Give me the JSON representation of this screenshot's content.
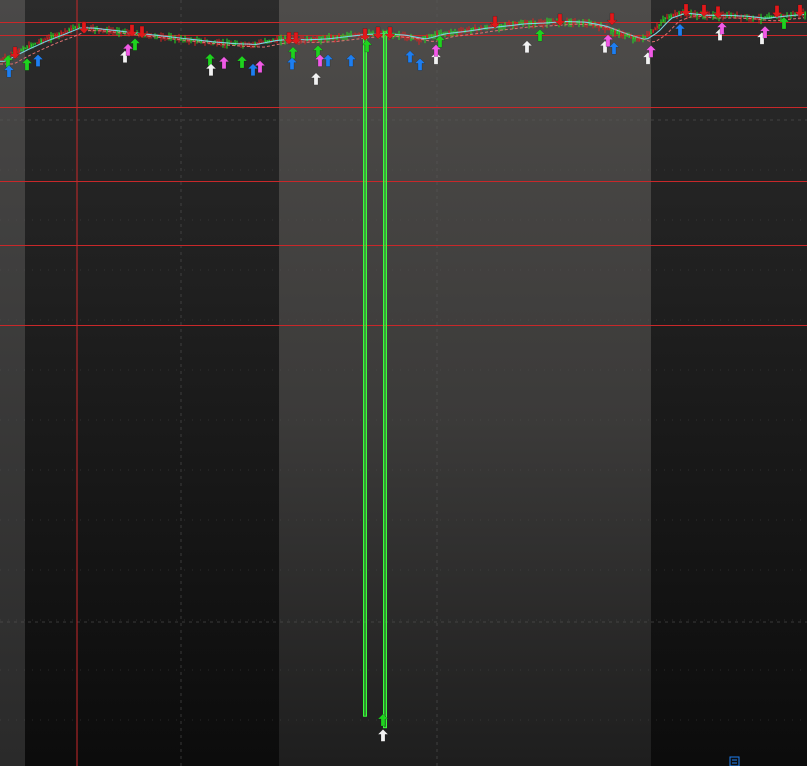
{
  "theme": {
    "bg_dark": "#0e0e0e",
    "bg_session_mid": "#3a3938",
    "bg_session_top": "#4a4948",
    "grid": "#5a5a5a",
    "level_line": "#c8282a",
    "bull": "#22e022",
    "bear": "#e02020",
    "ma_fast": "#7ad3e0",
    "ma_slow": "#e07070",
    "arrow_green": "#1fd21f",
    "arrow_red": "#e0191b",
    "arrow_blue": "#1e7ef0",
    "arrow_magenta": "#f05ae6",
    "arrow_white": "#f2f2f2",
    "spike": "#39ff39"
  },
  "chart_data": {
    "type": "candlestick",
    "title": "",
    "xlabel": "",
    "ylabel": "",
    "grid": true,
    "legend": "none",
    "ylim": [
      0,
      100
    ],
    "price_path": [
      [
        0,
        92.0
      ],
      [
        8,
        92.6
      ],
      [
        20,
        93.4
      ],
      [
        40,
        94.6
      ],
      [
        60,
        95.6
      ],
      [
        75,
        96.4
      ],
      [
        90,
        96.3
      ],
      [
        110,
        96.0
      ],
      [
        130,
        95.7
      ],
      [
        150,
        95.4
      ],
      [
        170,
        95.1
      ],
      [
        190,
        94.8
      ],
      [
        210,
        94.5
      ],
      [
        230,
        94.3
      ],
      [
        250,
        94.2
      ],
      [
        270,
        94.7
      ],
      [
        285,
        94.9
      ],
      [
        300,
        94.8
      ],
      [
        320,
        94.9
      ],
      [
        340,
        95.2
      ],
      [
        360,
        95.5
      ],
      [
        380,
        95.6
      ],
      [
        400,
        95.4
      ],
      [
        420,
        94.9
      ],
      [
        440,
        95.6
      ],
      [
        460,
        95.9
      ],
      [
        480,
        96.3
      ],
      [
        500,
        96.6
      ],
      [
        520,
        96.9
      ],
      [
        540,
        97.0
      ],
      [
        560,
        97.2
      ],
      [
        580,
        97.1
      ],
      [
        600,
        96.6
      ],
      [
        620,
        95.6
      ],
      [
        640,
        94.8
      ],
      [
        652,
        95.8
      ],
      [
        665,
        97.6
      ],
      [
        680,
        98.3
      ],
      [
        700,
        98.0
      ],
      [
        720,
        98.0
      ],
      [
        740,
        97.9
      ],
      [
        760,
        97.6
      ],
      [
        780,
        97.9
      ],
      [
        805,
        98.2
      ]
    ],
    "levels": [
      97.1,
      95.4,
      86.0,
      76.4,
      68.0,
      57.6
    ],
    "spikes": [
      {
        "x": 365,
        "low": 6.5
      },
      {
        "x": 385,
        "low": 5.0
      }
    ],
    "signals": [
      {
        "x": 8,
        "kind": "green",
        "dir": "up",
        "y": 92.0
      },
      {
        "x": 9,
        "kind": "blue",
        "dir": "up",
        "y": 90.7
      },
      {
        "x": 15,
        "kind": "red",
        "dir": "down",
        "y": 93.1
      },
      {
        "x": 27,
        "kind": "green",
        "dir": "up",
        "y": 91.6
      },
      {
        "x": 38,
        "kind": "blue",
        "dir": "up",
        "y": 92.1
      },
      {
        "x": 84,
        "kind": "red",
        "dir": "down",
        "y": 96.4
      },
      {
        "x": 125,
        "kind": "white",
        "dir": "up",
        "y": 92.6
      },
      {
        "x": 128,
        "kind": "magenta",
        "dir": "up",
        "y": 93.5
      },
      {
        "x": 132,
        "kind": "red",
        "dir": "down",
        "y": 96.0
      },
      {
        "x": 135,
        "kind": "green",
        "dir": "up",
        "y": 94.2
      },
      {
        "x": 142,
        "kind": "red",
        "dir": "down",
        "y": 95.8
      },
      {
        "x": 210,
        "kind": "green",
        "dir": "up",
        "y": 92.2
      },
      {
        "x": 211,
        "kind": "white",
        "dir": "up",
        "y": 90.9
      },
      {
        "x": 224,
        "kind": "magenta",
        "dir": "up",
        "y": 91.8
      },
      {
        "x": 242,
        "kind": "green",
        "dir": "up",
        "y": 91.9
      },
      {
        "x": 253,
        "kind": "blue",
        "dir": "up",
        "y": 90.9
      },
      {
        "x": 260,
        "kind": "magenta",
        "dir": "up",
        "y": 91.3
      },
      {
        "x": 289,
        "kind": "red",
        "dir": "down",
        "y": 95.0
      },
      {
        "x": 293,
        "kind": "green",
        "dir": "up",
        "y": 93.1
      },
      {
        "x": 296,
        "kind": "red",
        "dir": "down",
        "y": 95.0
      },
      {
        "x": 292,
        "kind": "blue",
        "dir": "up",
        "y": 91.7
      },
      {
        "x": 316,
        "kind": "white",
        "dir": "up",
        "y": 89.7
      },
      {
        "x": 318,
        "kind": "green",
        "dir": "up",
        "y": 93.3
      },
      {
        "x": 320,
        "kind": "magenta",
        "dir": "up",
        "y": 92.1
      },
      {
        "x": 328,
        "kind": "blue",
        "dir": "up",
        "y": 92.1
      },
      {
        "x": 351,
        "kind": "blue",
        "dir": "up",
        "y": 92.1
      },
      {
        "x": 365,
        "kind": "red",
        "dir": "down",
        "y": 95.5
      },
      {
        "x": 367,
        "kind": "green",
        "dir": "up",
        "y": 94.0
      },
      {
        "x": 378,
        "kind": "red",
        "dir": "down",
        "y": 95.7
      },
      {
        "x": 390,
        "kind": "red",
        "dir": "down",
        "y": 95.7
      },
      {
        "x": 410,
        "kind": "blue",
        "dir": "up",
        "y": 92.6
      },
      {
        "x": 420,
        "kind": "blue",
        "dir": "up",
        "y": 91.6
      },
      {
        "x": 436,
        "kind": "white",
        "dir": "up",
        "y": 92.4
      },
      {
        "x": 436,
        "kind": "magenta",
        "dir": "up",
        "y": 93.4
      },
      {
        "x": 440,
        "kind": "green",
        "dir": "up",
        "y": 94.6
      },
      {
        "x": 495,
        "kind": "red",
        "dir": "down",
        "y": 97.1
      },
      {
        "x": 527,
        "kind": "white",
        "dir": "up",
        "y": 93.9
      },
      {
        "x": 540,
        "kind": "green",
        "dir": "up",
        "y": 95.4
      },
      {
        "x": 560,
        "kind": "red",
        "dir": "down",
        "y": 97.4
      },
      {
        "x": 605,
        "kind": "white",
        "dir": "up",
        "y": 93.9
      },
      {
        "x": 608,
        "kind": "magenta",
        "dir": "up",
        "y": 94.7
      },
      {
        "x": 612,
        "kind": "red",
        "dir": "down",
        "y": 97.5
      },
      {
        "x": 614,
        "kind": "blue",
        "dir": "up",
        "y": 93.7
      },
      {
        "x": 648,
        "kind": "white",
        "dir": "up",
        "y": 92.4
      },
      {
        "x": 651,
        "kind": "magenta",
        "dir": "up",
        "y": 93.3
      },
      {
        "x": 680,
        "kind": "blue",
        "dir": "up",
        "y": 96.1
      },
      {
        "x": 686,
        "kind": "red",
        "dir": "down",
        "y": 98.7
      },
      {
        "x": 704,
        "kind": "red",
        "dir": "down",
        "y": 98.6
      },
      {
        "x": 718,
        "kind": "red",
        "dir": "down",
        "y": 98.4
      },
      {
        "x": 720,
        "kind": "white",
        "dir": "up",
        "y": 95.5
      },
      {
        "x": 722,
        "kind": "magenta",
        "dir": "up",
        "y": 96.3
      },
      {
        "x": 762,
        "kind": "white",
        "dir": "up",
        "y": 95.0
      },
      {
        "x": 765,
        "kind": "magenta",
        "dir": "up",
        "y": 95.8
      },
      {
        "x": 777,
        "kind": "red",
        "dir": "down",
        "y": 98.5
      },
      {
        "x": 784,
        "kind": "green",
        "dir": "up",
        "y": 97.0
      },
      {
        "x": 800,
        "kind": "red",
        "dir": "down",
        "y": 98.6
      },
      {
        "x": 383,
        "kind": "green",
        "dir": "up",
        "y": 6.0
      },
      {
        "x": 383,
        "kind": "white",
        "dir": "up",
        "y": 4.0
      }
    ]
  }
}
